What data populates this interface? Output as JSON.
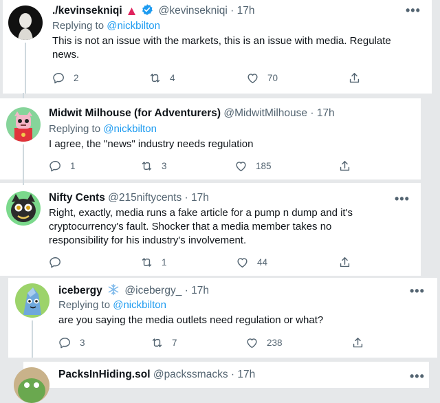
{
  "tweets": [
    {
      "name": "./kevinsekniqi",
      "handle": "@kevinsekniqi",
      "separator": "·",
      "time": "17h",
      "replying_label": "Replying to",
      "replying_to": "@nickbilton",
      "text": "This is not an issue with the markets, this is an issue with media. Regulate news.",
      "replies": "2",
      "retweets": "4",
      "likes": "70",
      "badges": [
        "red-triangle-icon",
        "verified-badge-icon"
      ]
    },
    {
      "name": "Midwit Milhouse (for Adventurers)",
      "handle": "@MidwitMilhouse",
      "separator": "·",
      "time": "17h",
      "replying_label": "Replying to",
      "replying_to": "@nickbilton",
      "text": "I agree, the \"news\" industry needs regulation",
      "replies": "1",
      "retweets": "3",
      "likes": "185"
    },
    {
      "name": "Nifty Cents",
      "handle": "@215niftycents",
      "separator": "·",
      "time": "17h",
      "text": "Right, exactly, media runs a fake article for a pump n dump and it's cryptocurrency's fault.  Shocker that a media member takes no responsibility for his industry's involvement.",
      "replies": "",
      "retweets": "1",
      "likes": "44"
    },
    {
      "name": "icebergy",
      "handle": "@icebergy_",
      "separator": "·",
      "time": "17h",
      "replying_label": "Replying to",
      "replying_to": "@nickbilton",
      "text": "are you saying the media outlets need regulation or what?",
      "replies": "3",
      "retweets": "7",
      "likes": "238",
      "badges": [
        "snowflake-icon"
      ]
    },
    {
      "name": "PacksInHiding.sol",
      "handle": "@packssmacks",
      "separator": "·",
      "time": "17h"
    }
  ],
  "more_label": "•••",
  "colors": {
    "link": "#1d9bf0",
    "secondary_text": "#536471",
    "primary_text": "#0f1419",
    "verified": "#1d9bf0",
    "thread_line": "#cfd9de"
  }
}
